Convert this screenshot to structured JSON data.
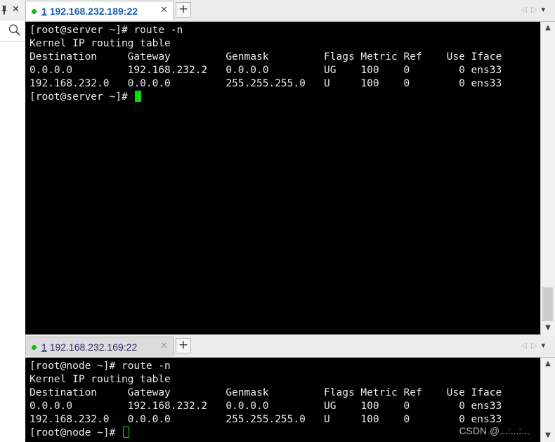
{
  "sidebar": {
    "pin_icon": "pin-icon",
    "close_icon": "close-icon",
    "search_icon": "search-icon"
  },
  "pane1": {
    "tab": {
      "num": "1",
      "title": "192.168.232.189:22",
      "status_color": "#1bb41b"
    },
    "lines": [
      "[root@server ~]# route -n",
      "Kernel IP routing table",
      "Destination     Gateway         Genmask         Flags Metric Ref    Use Iface",
      "0.0.0.0         192.168.232.2   0.0.0.0         UG    100    0        0 ens33",
      "192.168.232.0   0.0.0.0         255.255.255.0   U     100    0        0 ens33",
      "[root@server ~]# "
    ],
    "scroll": {
      "position": 1.0
    }
  },
  "pane2": {
    "tab": {
      "num": "1",
      "title": "192.168.232.169:22",
      "status_color": "#1bb41b"
    },
    "lines": [
      "[root@node ~]# route -n",
      "Kernel IP routing table",
      "Destination     Gateway         Genmask         Flags Metric Ref    Use Iface",
      "0.0.0.0         192.168.232.2   0.0.0.0         UG    100    0        0 ens33",
      "192.168.232.0   0.0.0.0         255.255.255.0   U     100    0        0 ens33",
      "[root@node ~]# "
    ]
  },
  "controls": {
    "add_tab": "+",
    "close_tab": "✕",
    "nav_prev": "◁",
    "nav_next": "▷",
    "nav_menu": "▾"
  },
  "watermark": "CSDN @...:...:...",
  "colors": {
    "terminal_bg": "#000000",
    "terminal_fg": "#e8e8e8",
    "cursor": "#00e000",
    "tab_active_text": "#1a5fb4"
  }
}
